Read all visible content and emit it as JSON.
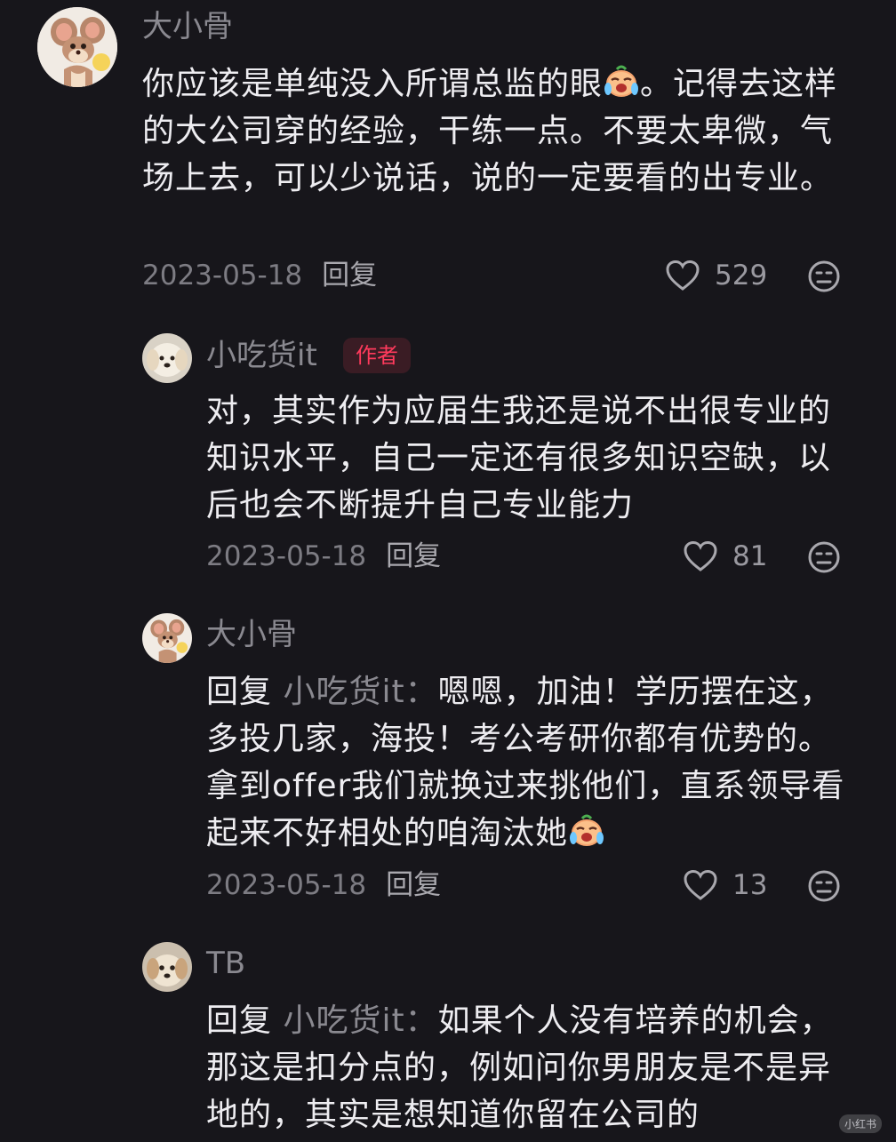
{
  "comments": [
    {
      "username": "大小骨",
      "body_lines": [
        "你应该是单纯没入所谓总监的眼",
        "。记得去这样的大公司穿的经验，干练一点。不要太卑微，气场上去，可以少说话，说的一定要看的出专业。"
      ],
      "date": "2023-05-18",
      "reply_label": "回复",
      "likes": "529",
      "avatar_icon": "jerry-mouse-avatar-icon",
      "emoji_icon": "crying-laughing-emoji-icon"
    },
    {
      "username": "小吃货it",
      "badge": "作者",
      "body": "对，其实作为应届生我还是说不出很专业的知识水平，自己一定还有很多知识空缺，以后也会不断提升自己专业能力",
      "date": "2023-05-18",
      "reply_label": "回复",
      "likes": "81",
      "avatar_icon": "dog-avatar-icon"
    },
    {
      "username": "大小骨",
      "reply_prefix": "回复",
      "reply_target": "小吃货it：",
      "body": "嗯嗯，加油！学历摆在这，多投几家，海投！考公考研你都有优势的。拿到offer我们就换过来挑他们，直系领导看起来不好相处的咱淘汰她",
      "date": "2023-05-18",
      "reply_label": "回复",
      "likes": "13",
      "avatar_icon": "jerry-mouse-avatar-icon",
      "emoji_icon": "crying-laughing-emoji-icon"
    },
    {
      "username": "TB",
      "reply_prefix": "回复",
      "reply_target": "小吃货it：",
      "body": "如果个人没有培养的机会，那这是扣分点的，例如问你男朋友是不是异地的，其实是想知道你留在公司的",
      "avatar_icon": "puppy-avatar-icon"
    }
  ],
  "colors": {
    "background": "#17161b",
    "badge_text": "#ff3a5c",
    "muted": "#8a8990"
  },
  "watermark": "小红书"
}
